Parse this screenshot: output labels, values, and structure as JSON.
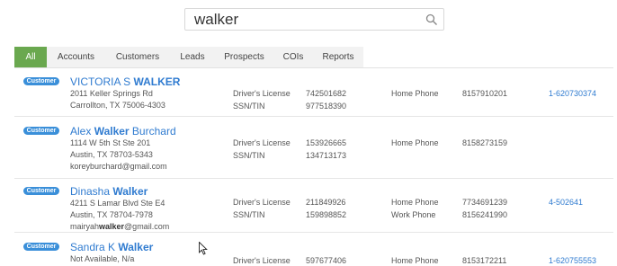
{
  "search": {
    "query": "walker"
  },
  "tabs": [
    "All",
    "Accounts",
    "Customers",
    "Leads",
    "Prospects",
    "COIs",
    "Reports"
  ],
  "results": [
    {
      "badge": "Customer",
      "name_pre": "VICTORIA S ",
      "name_match": "WALKER",
      "name_post": "",
      "address1": "2011 Keller Springs Rd",
      "address2": "Carrollton, TX 75006-4303",
      "ids": [
        {
          "label": "Driver's License",
          "value": "742501682"
        },
        {
          "label": "SSN/TIN",
          "value": "977518390"
        }
      ],
      "phones": [
        {
          "label": "Home Phone",
          "value": "8157910201"
        }
      ],
      "link": "1-620730374"
    },
    {
      "badge": "Customer",
      "name_pre": "Alex ",
      "name_match": "Walker",
      "name_post": " Burchard",
      "address1": "1114 W 5th St Ste 201",
      "address2": "Austin, TX 78703-5343",
      "email": "koreyburchard@gmail.com",
      "ids": [
        {
          "label": "Driver's License",
          "value": "153926665"
        },
        {
          "label": "SSN/TIN",
          "value": "134713173"
        }
      ],
      "phones": [
        {
          "label": "Home Phone",
          "value": "8158273159"
        }
      ]
    },
    {
      "badge": "Customer",
      "name_pre": "Dinasha ",
      "name_match": "Walker",
      "name_post": "",
      "address1": "4211 S Lamar Blvd Ste E4",
      "address2": "Austin, TX 78704-7978",
      "email_pre": "mairyah",
      "email_match": "walker",
      "email_post": "@gmail.com",
      "ids": [
        {
          "label": "Driver's License",
          "value": "211849926"
        },
        {
          "label": "SSN/TIN",
          "value": "159898852"
        }
      ],
      "phones": [
        {
          "label": "Home Phone",
          "value": "7734691239"
        },
        {
          "label": "Work Phone",
          "value": "8156241990"
        }
      ],
      "link": "4-502641"
    },
    {
      "badge": "Customer",
      "name_pre": "Sandra K ",
      "name_match": "Walker",
      "name_post": "",
      "address1": "Not Available, N/a",
      "ids": [
        {
          "label": "Driver's License",
          "value": "597677406"
        }
      ],
      "phones": [
        {
          "label": "Home Phone",
          "value": "8153172211"
        }
      ],
      "link": "1-620755553"
    }
  ]
}
